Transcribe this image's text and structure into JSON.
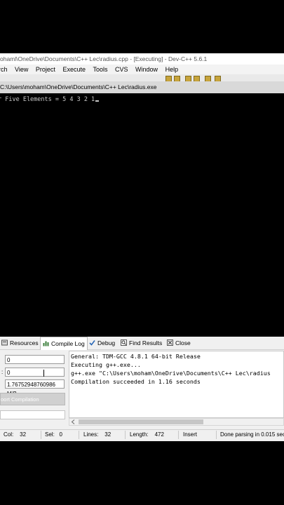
{
  "window": {
    "title": "ohaml\\OneDrive\\Documents\\C++ Lec\\radius.cpp - [Executing] - Dev-C++ 5.6.1"
  },
  "menu": [
    "rch",
    "View",
    "Project",
    "Execute",
    "Tools",
    "CVS",
    "Window",
    "Help"
  ],
  "console": {
    "title": "C:\\Users\\moham\\OneDrive\\Documents\\C++ Lec\\radius.exe",
    "output": "r Five Elements = 5 4 3 2 1"
  },
  "tabs": [
    {
      "label": "Resources",
      "icon": "resources-icon"
    },
    {
      "label": "Compile Log",
      "icon": "compile-log-icon"
    },
    {
      "label": "Debug",
      "icon": "debug-check-icon"
    },
    {
      "label": "Find Results",
      "icon": "find-results-icon"
    },
    {
      "label": "Close",
      "icon": "close-icon"
    }
  ],
  "compile_panel": {
    "errors_value": "0",
    "warnings_value": "0",
    "output_size": "1.76752948760986 MiB",
    "abort_label": "oort Compilation"
  },
  "log_lines": [
    "General: TDM-GCC 4.8.1 64-bit Release",
    "Executing g++.exe...",
    "g++.exe \"C:\\Users\\moham\\OneDrive\\Documents\\C++ Lec\\radius",
    "Compilation succeeded in 1.16 seconds"
  ],
  "status": {
    "col_label": "Col:",
    "col_value": "32",
    "sel_label": "Sel:",
    "sel_value": "0",
    "lines_label": "Lines:",
    "lines_value": "32",
    "length_label": "Length:",
    "length_value": "472",
    "mode": "Insert",
    "message": "Done parsing in 0.015 seco"
  },
  "colors": {
    "accent_icon": "#c7a43c",
    "console_bg": "#000000",
    "log_bg": "#ffffff"
  }
}
